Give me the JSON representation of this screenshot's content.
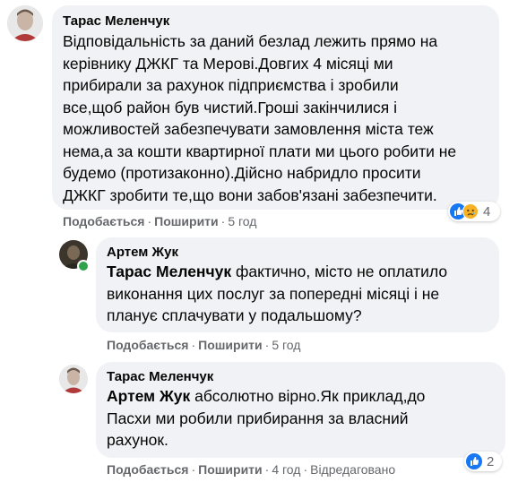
{
  "comments": [
    {
      "author": "Тарас Меленчук",
      "lines": [
        "Відповідальність за даний безлад лежить прямо на",
        "керівнику ДЖКГ та Мерові.Довгих 4 місяці ми",
        "прибирали за рахунок підприємства і зробили",
        "все,щоб район був чистий.Гроші закінчилися і",
        "можливостей забезпечувати замовлення міста теж",
        "нема,а за кошти квартирної плати ми цього робити не",
        "будемо (протизаконно).Дійсно набридло просити",
        "ДЖКГ зробити те,що вони забов'язані забезпечити."
      ],
      "like_label": "Подобається",
      "share_label": "Поширити",
      "time": "5 год",
      "reaction_count": "4"
    },
    {
      "author": "Артем Жук",
      "mention": "Тарас Меленчук",
      "first_line_rest": "фактично, місто не оплатило",
      "lines": [
        "виконання цих послуг за попередні місяці і не",
        "планує сплачувати у подальшому?"
      ],
      "like_label": "Подобається",
      "share_label": "Поширити",
      "time": "5 год"
    },
    {
      "author": "Тарас Меленчук",
      "mention": "Артем Жук",
      "first_line_rest": "абсолютно вірно.Як приклад,до",
      "lines": [
        "Пасхи ми робили прибирання за власний",
        "рахунок."
      ],
      "like_label": "Подобається",
      "share_label": "Поширити",
      "time": "4 год",
      "edited_label": "Відредаговано",
      "reaction_count": "2"
    }
  ],
  "separator": "·",
  "colors": {
    "bubble": "#f0f2f5",
    "meta_text": "#65676b",
    "like_blue": "#1877f2",
    "online_green": "#31a24c"
  }
}
